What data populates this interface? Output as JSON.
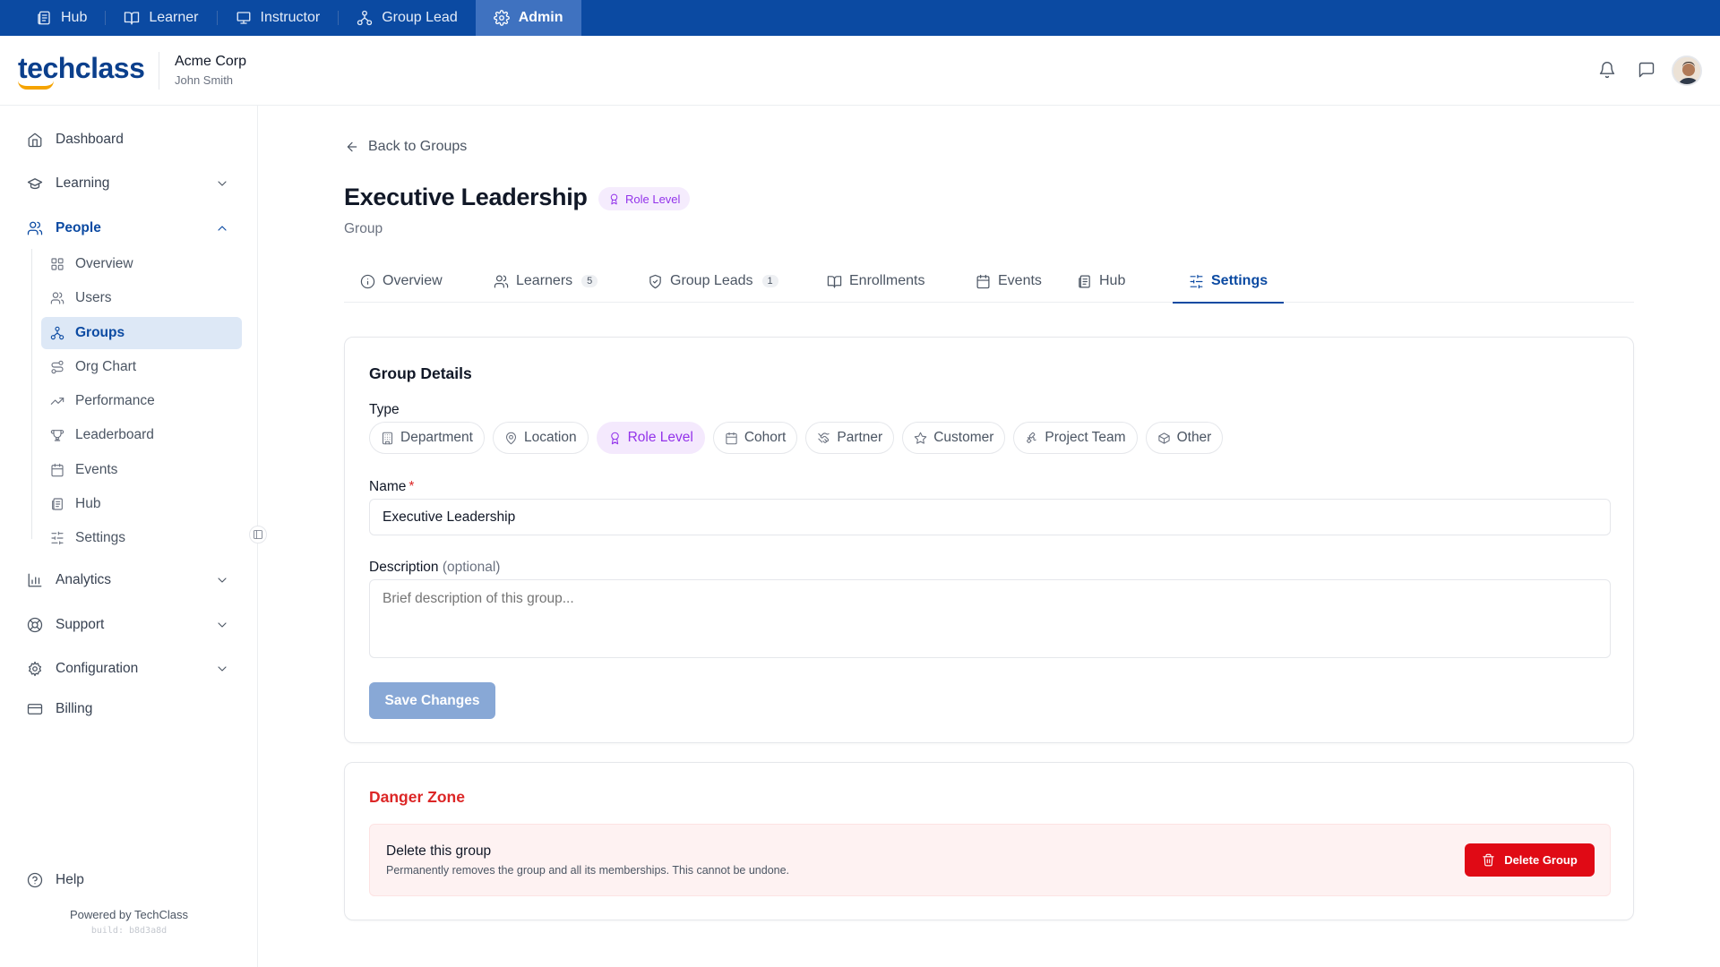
{
  "roles": [
    {
      "label": "Hub",
      "icon": "newspaper-icon"
    },
    {
      "label": "Learner",
      "icon": "book-open-icon"
    },
    {
      "label": "Instructor",
      "icon": "presentation-icon"
    },
    {
      "label": "Group Lead",
      "icon": "network-icon"
    },
    {
      "label": "Admin",
      "icon": "gear-icon",
      "active": true
    }
  ],
  "header": {
    "logo_text": "techclass",
    "org_name": "Acme Corp",
    "user_name": "John Smith"
  },
  "sidebar": {
    "items": [
      {
        "label": "Dashboard",
        "icon": "home-icon"
      },
      {
        "label": "Learning",
        "icon": "graduation-cap-icon",
        "expandable": true
      },
      {
        "label": "People",
        "icon": "users-icon",
        "expandable": true,
        "expanded": true,
        "active": true
      },
      {
        "label": "Analytics",
        "icon": "bar-chart-icon",
        "expandable": true
      },
      {
        "label": "Support",
        "icon": "life-buoy-icon",
        "expandable": true
      },
      {
        "label": "Configuration",
        "icon": "gear-icon",
        "expandable": true
      },
      {
        "label": "Billing",
        "icon": "credit-card-icon"
      }
    ],
    "people_sub": [
      {
        "label": "Overview",
        "icon": "grid-icon"
      },
      {
        "label": "Users",
        "icon": "users-icon"
      },
      {
        "label": "Groups",
        "icon": "network-icon",
        "active": true
      },
      {
        "label": "Org Chart",
        "icon": "route-icon"
      },
      {
        "label": "Performance",
        "icon": "trending-up-icon"
      },
      {
        "label": "Leaderboard",
        "icon": "trophy-icon"
      },
      {
        "label": "Events",
        "icon": "calendar-icon"
      },
      {
        "label": "Hub",
        "icon": "newspaper-icon"
      },
      {
        "label": "Settings",
        "icon": "sliders-icon"
      }
    ],
    "help_label": "Help",
    "powered_by": "Powered by TechClass",
    "build": "build: b8d3a8d"
  },
  "page": {
    "back_label": "Back to Groups",
    "title": "Executive Leadership",
    "badge": "Role Level",
    "subtitle": "Group"
  },
  "tabs": [
    {
      "label": "Overview",
      "icon": "info-icon"
    },
    {
      "label": "Learners",
      "icon": "users-icon",
      "count": "5"
    },
    {
      "label": "Group Leads",
      "icon": "shield-icon",
      "count": "1"
    },
    {
      "label": "Enrollments",
      "icon": "book-open-icon"
    },
    {
      "label": "Events",
      "icon": "calendar-icon"
    },
    {
      "label": "Hub",
      "icon": "newspaper-icon"
    },
    {
      "label": "Settings",
      "icon": "sliders-icon",
      "active": true
    }
  ],
  "details": {
    "title": "Group Details",
    "type_label": "Type",
    "types": [
      {
        "label": "Department",
        "icon": "building-icon"
      },
      {
        "label": "Location",
        "icon": "map-pin-icon"
      },
      {
        "label": "Role Level",
        "icon": "award-icon",
        "selected": true
      },
      {
        "label": "Cohort",
        "icon": "calendar-icon"
      },
      {
        "label": "Partner",
        "icon": "handshake-icon"
      },
      {
        "label": "Customer",
        "icon": "star-icon"
      },
      {
        "label": "Project Team",
        "icon": "puzzle-icon"
      },
      {
        "label": "Other",
        "icon": "box-icon"
      }
    ],
    "name_label": "Name",
    "name_required": "*",
    "name_value": "Executive Leadership",
    "description_label": "Description",
    "description_optional": "(optional)",
    "description_placeholder": "Brief description of this group...",
    "save_label": "Save Changes"
  },
  "danger": {
    "title": "Danger Zone",
    "heading": "Delete this group",
    "description": "Permanently removes the group and all its memberships. This cannot be undone.",
    "button_label": "Delete Group"
  },
  "colors": {
    "brand": "#0b4aa2",
    "accent_purple": "#9333ea",
    "danger": "#dc2626"
  }
}
